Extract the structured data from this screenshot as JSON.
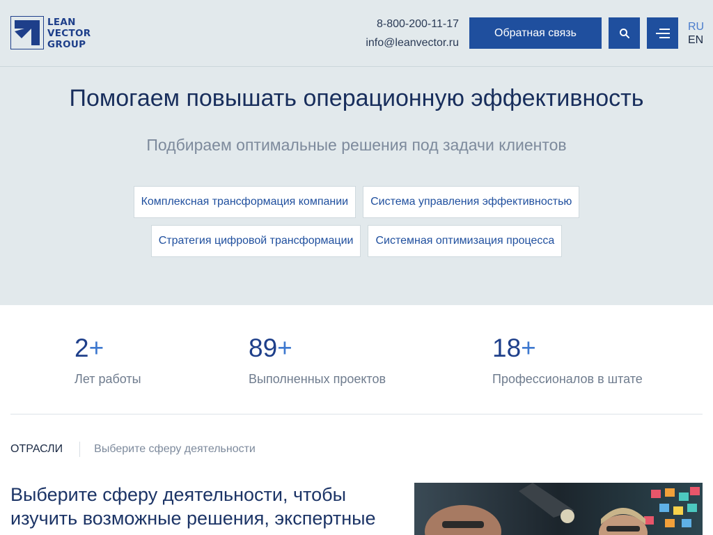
{
  "brand": {
    "logo_lines": [
      "LEAN",
      "VECTOR",
      "GROUP"
    ]
  },
  "header": {
    "phone": "8-800-200-11-17",
    "email": "info@leanvector.ru",
    "callback_label": "Обратная связь",
    "search_icon": "search-icon",
    "menu_icon": "menu-icon",
    "lang_ru": "RU",
    "lang_en": "EN"
  },
  "hero": {
    "title": "Помогаем повышать операционную эффективность",
    "subtitle": "Подбираем оптимальные решения под задачи клиентов",
    "chips": [
      "Комплексная трансформация компании",
      "Система управления эффективностью",
      "Стратегия цифровой трансформации",
      "Системная оптимизация процесса"
    ]
  },
  "stats": [
    {
      "number": "2",
      "suffix": "+",
      "label": "Лет работы"
    },
    {
      "number": "89",
      "suffix": "+",
      "label": "Выполненных проектов"
    },
    {
      "number": "18",
      "suffix": "+",
      "label": "Профессионалов в штате"
    }
  ],
  "industries": {
    "crumb_main": "ОТРАСЛИ",
    "crumb_sub": "Выберите сферу деятельности",
    "title": "Выберите сферу деятельности, чтобы изучить возможные решения, экспертные"
  },
  "colors": {
    "accent": "#1f4f9e",
    "hero_bg": "#e2e9ec",
    "title": "#182e5c",
    "plus": "#3d78cf"
  }
}
